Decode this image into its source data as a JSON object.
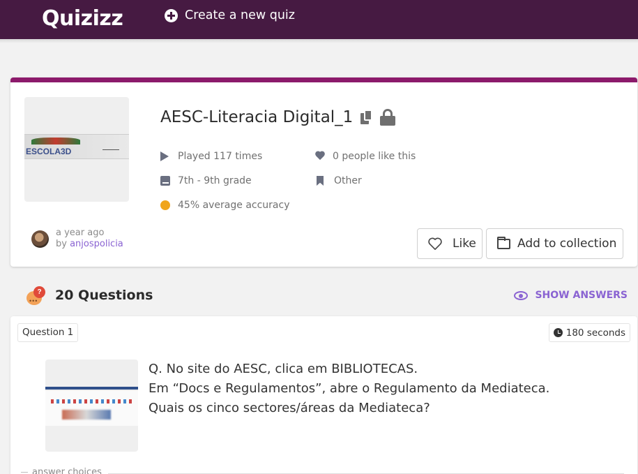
{
  "header": {
    "logo_text": "Quizizz",
    "create_label": "Create a new quiz"
  },
  "quiz": {
    "title": "AESC-Literacia Digital_1",
    "thumbnail_caption": "ESCOLA3D",
    "played": "Played 117 times",
    "likes": "0 people like this",
    "grade": "7th - 9th grade",
    "subject": "Other",
    "accuracy": "45% average accuracy",
    "created": "a year ago",
    "by_prefix": "by ",
    "author": "anjospolicia",
    "like_label": "Like",
    "collection_label": "Add to collection"
  },
  "questions_section": {
    "count_label": "20 Questions",
    "show_answers_label": "SHOW ANSWERS"
  },
  "question": {
    "label": "Question 1",
    "time": "180 seconds",
    "lines": [
      "Q. No site do AESC, clica em BIBLIOTECAS.",
      "Em “Docs e Regulamentos”, abre o Regulamento da Mediateca.",
      "Quais os cinco sectores/áreas da Mediateca?"
    ],
    "answer_label": "answer choices"
  },
  "colors": {
    "topbar": "#461a42",
    "accent_stripe": "#8c1a6b",
    "link_purple": "#8a63d2",
    "accuracy_dot": "#f0a51b"
  },
  "icons": [
    "plus-circle-icon",
    "copy-icon",
    "lock-icon",
    "play-icon",
    "heart-icon",
    "book-icon",
    "bookmark-icon",
    "dot-icon",
    "heart-outline-icon",
    "folder-icon",
    "chat-bubble-icon",
    "eye-icon",
    "clock-icon"
  ]
}
